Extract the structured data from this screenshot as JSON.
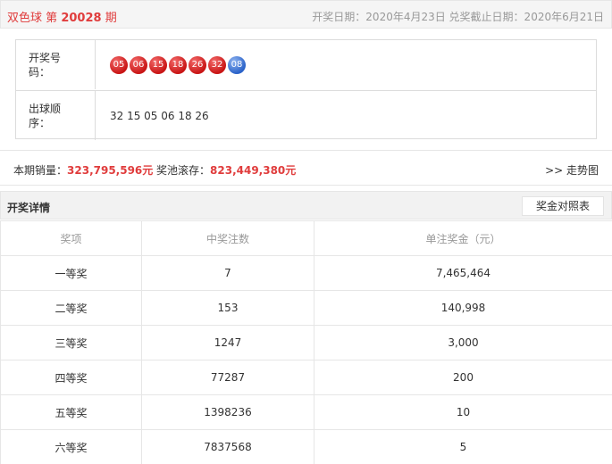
{
  "header": {
    "lottery": "双色球",
    "issue_prefix": "第",
    "issue": "20028",
    "issue_suffix": "期",
    "dates": "开奖日期：2020年4月23日 兑奖截止日期：2020年6月21日"
  },
  "draw": {
    "numbers_label_1": "开奖号",
    "numbers_label_2": "码：",
    "red_balls": [
      "05",
      "06",
      "15",
      "18",
      "26",
      "32"
    ],
    "blue_ball": "08",
    "order_label_1": "出球顺",
    "order_label_2": "序：",
    "order": "32 15 05 06 18 26"
  },
  "sales": {
    "sales_label": "本期销量：",
    "sales_amount": "323,795,596元",
    "pool_label": "奖池滚存：",
    "pool_amount": "823,449,380元",
    "trend_link": ">> 走势图"
  },
  "detail": {
    "title": "开奖详情",
    "compare_button": "奖金对照表",
    "columns": [
      "奖项",
      "中奖注数",
      "单注奖金（元）"
    ],
    "rows": [
      [
        "一等奖",
        "7",
        "7,465,464"
      ],
      [
        "二等奖",
        "153",
        "140,998"
      ],
      [
        "三等奖",
        "1247",
        "3,000"
      ],
      [
        "四等奖",
        "77287",
        "200"
      ],
      [
        "五等奖",
        "1398236",
        "10"
      ],
      [
        "六等奖",
        "7837568",
        "5"
      ]
    ]
  },
  "colors": {
    "accent_red": "#e03c3c",
    "ball_red": "#c91515",
    "ball_blue": "#2b63c9"
  }
}
